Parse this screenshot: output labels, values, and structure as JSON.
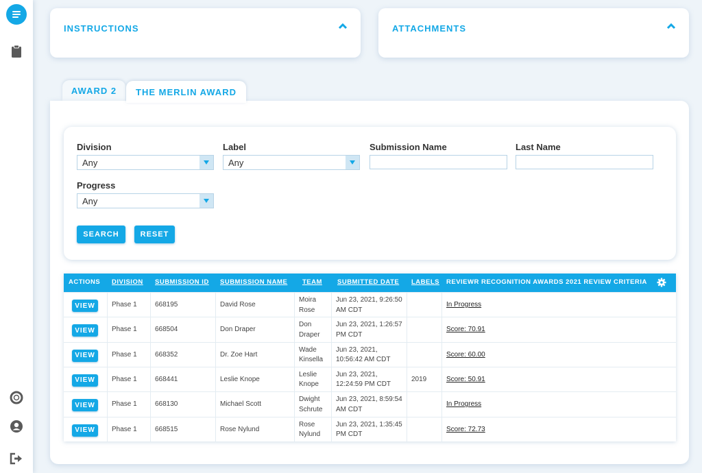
{
  "panels": {
    "instructions": "INSTRUCTIONS",
    "attachments": "ATTACHMENTS"
  },
  "tabs": [
    {
      "label": "AWARD 2",
      "active": false
    },
    {
      "label": "THE MERLIN AWARD",
      "active": true
    }
  ],
  "filters": {
    "division": {
      "label": "Division",
      "value": "Any"
    },
    "label": {
      "label": "Label",
      "value": "Any"
    },
    "submission_name": {
      "label": "Submission Name",
      "value": ""
    },
    "last_name": {
      "label": "Last Name",
      "value": ""
    },
    "progress": {
      "label": "Progress",
      "value": "Any"
    },
    "search_button": "SEARCH",
    "reset_button": "RESET"
  },
  "table": {
    "headers": {
      "actions": "ACTIONS",
      "division": "DIVISION",
      "submission_id": "SUBMISSION ID",
      "submission_name": "SUBMISSION NAME",
      "team": "TEAM",
      "submitted_date": "SUBMITTED DATE",
      "labels": "LABELS",
      "criteria": "REVIEWR RECOGNITION AWARDS 2021 REVIEW CRITERIA"
    },
    "view_label": "VIEW",
    "rows": [
      {
        "division": "Phase 1",
        "id": "668195",
        "name": "David Rose",
        "team1": "Moira",
        "team2": "Rose",
        "date1": "Jun 23, 2021, 9:26:50",
        "date2": "AM CDT",
        "labels": "",
        "status": "In Progress"
      },
      {
        "division": "Phase 1",
        "id": "668504",
        "name": "Don Draper",
        "team1": "Don",
        "team2": "Draper",
        "date1": "Jun 23, 2021, 1:26:57",
        "date2": "PM CDT",
        "labels": "",
        "status": "Score: 70.91"
      },
      {
        "division": "Phase 1",
        "id": "668352",
        "name": "Dr. Zoe Hart",
        "team1": "Wade",
        "team2": "Kinsella",
        "date1": "Jun 23, 2021,",
        "date2": "10:56:42 AM CDT",
        "labels": "",
        "status": "Score: 60.00"
      },
      {
        "division": "Phase 1",
        "id": "668441",
        "name": "Leslie Knope",
        "team1": "Leslie",
        "team2": "Knope",
        "date1": "Jun 23, 2021,",
        "date2": "12:24:59 PM CDT",
        "labels": "2019",
        "status": "Score: 50.91"
      },
      {
        "division": "Phase 1",
        "id": "668130",
        "name": "Michael Scott",
        "team1": "Dwight",
        "team2": "Schrute",
        "date1": "Jun 23, 2021, 8:59:54",
        "date2": "AM CDT",
        "labels": "",
        "status": "In Progress"
      },
      {
        "division": "Phase 1",
        "id": "668515",
        "name": "Rose Nylund",
        "team1": "Rose",
        "team2": "Nylund",
        "date1": "Jun 23, 2021, 1:35:45",
        "date2": "PM CDT",
        "labels": "",
        "status": "Score: 72.73"
      }
    ]
  },
  "colors": {
    "accent": "#14a8e6",
    "background": "#eef4f9"
  },
  "icons": [
    "chat-logo-icon",
    "clipboard-icon",
    "help-lifebuoy-icon",
    "user-profile-icon",
    "logout-icon",
    "chevron-up-icon",
    "dropdown-arrow-icon",
    "gear-icon"
  ]
}
